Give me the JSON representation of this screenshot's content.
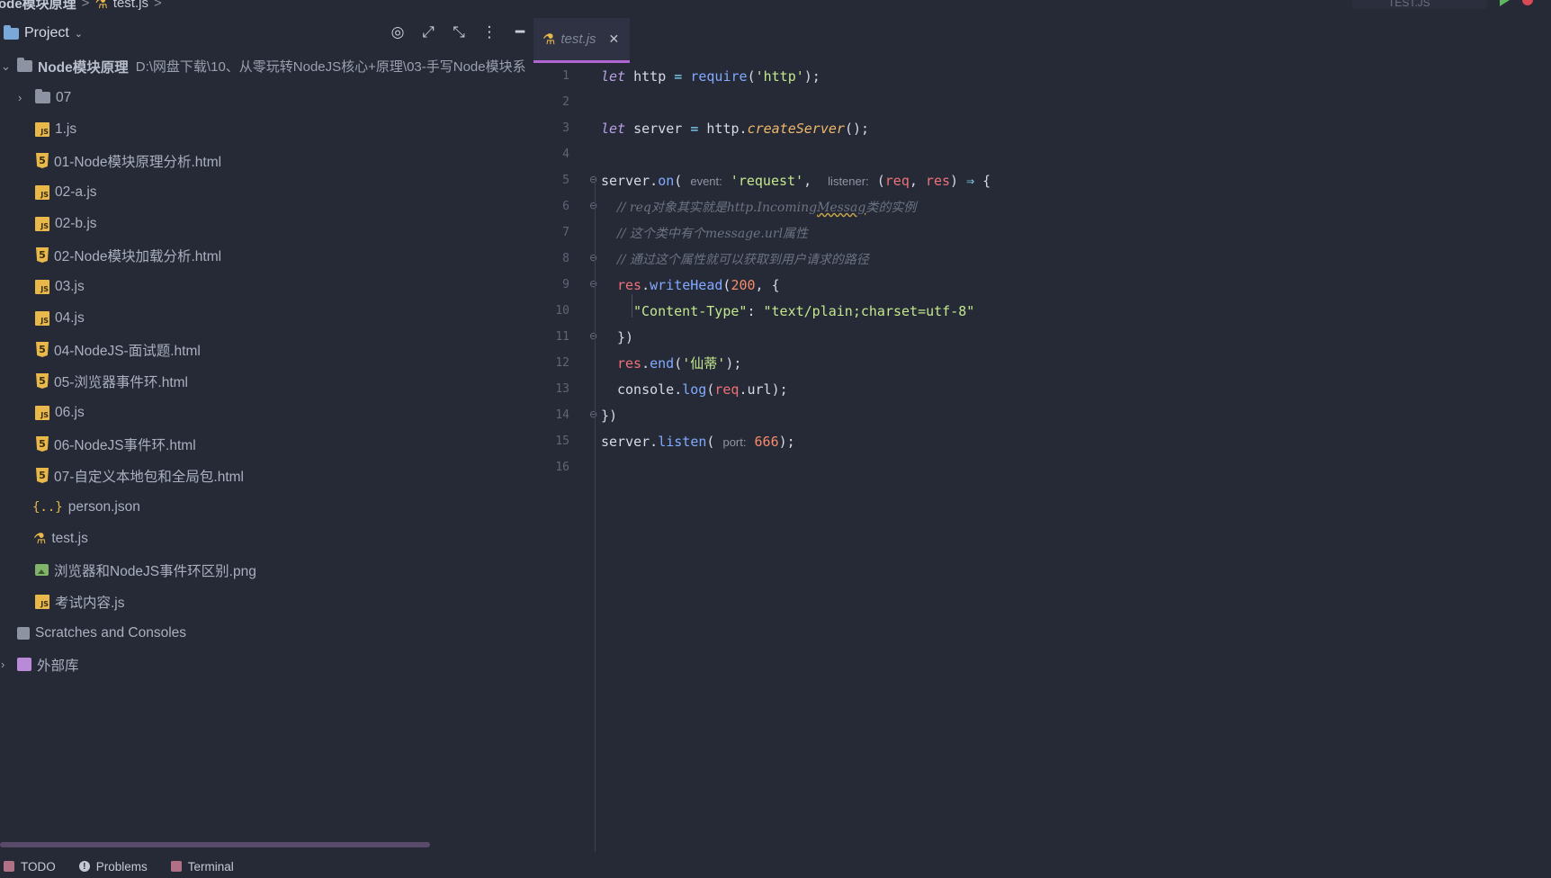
{
  "breadcrumb": {
    "project": "ode模块原理",
    "file": "test.js",
    "sep": ">"
  },
  "run": {
    "config_label": "TEST.JS"
  },
  "project_panel": {
    "title": "Project",
    "root": {
      "name": "Node模块原理",
      "path": "D:\\网盘下载\\10、从零玩转NodeJS核心+原理\\03-手写Node模块系"
    },
    "items": [
      {
        "name": "07",
        "type": "folder"
      },
      {
        "name": "1.js",
        "type": "js"
      },
      {
        "name": "01-Node模块原理分析.html",
        "type": "html"
      },
      {
        "name": "02-a.js",
        "type": "js"
      },
      {
        "name": "02-b.js",
        "type": "js"
      },
      {
        "name": "02-Node模块加载分析.html",
        "type": "html"
      },
      {
        "name": "03.js",
        "type": "js"
      },
      {
        "name": "04.js",
        "type": "js"
      },
      {
        "name": "04-NodeJS-面试题.html",
        "type": "html"
      },
      {
        "name": "05-浏览器事件环.html",
        "type": "html"
      },
      {
        "name": "06.js",
        "type": "js"
      },
      {
        "name": "06-NodeJS事件环.html",
        "type": "html"
      },
      {
        "name": "07-自定义本地包和全局包.html",
        "type": "html"
      },
      {
        "name": "person.json",
        "type": "json"
      },
      {
        "name": "test.js",
        "type": "test"
      },
      {
        "name": "浏览器和NodeJS事件环区别.png",
        "type": "png"
      },
      {
        "name": "考试内容.js",
        "type": "js"
      }
    ],
    "scratches": "Scratches and Consoles",
    "external_libs": "外部库"
  },
  "editor": {
    "tab_name": "test.js",
    "line_numbers": [
      "1",
      "2",
      "3",
      "4",
      "5",
      "6",
      "7",
      "8",
      "9",
      "10",
      "11",
      "12",
      "13",
      "14",
      "15",
      "16"
    ],
    "code": {
      "l1_kw": "let",
      "l1_a": " http ",
      "l1_eq": "=",
      "l1_fn": " require",
      "l1_p1": "(",
      "l1_str": "'http'",
      "l1_p2": ");",
      "l3_kw": "let",
      "l3_a": " server ",
      "l3_eq": "=",
      "l3_b": " http.",
      "l3_fn": "createServer",
      "l3_p": "();",
      "l5_a": "server.",
      "l5_fn": "on",
      "l5_p1": "( ",
      "l5_hint1": "event:",
      "l5_str": "'request'",
      "l5_comma": ",  ",
      "l5_hint2": "listener:",
      "l5_p2": " (",
      "l5_v1": "req",
      "l5_c": ", ",
      "l5_v2": "res",
      "l5_p3": ") ",
      "l5_arrow": "⇒",
      "l5_brace": " {",
      "l6_cmt1": "// req对象其实就是http.Incoming",
      "l6_squig": "Messag",
      "l6_cmt2": "类的实例",
      "l7_cmt": "// 这个类中有个message.url属性",
      "l8_cmt": "// 通过这个属性就可以获取到用户请求的路径",
      "l9_v": "res",
      "l9_dot": ".",
      "l9_fn": "writeHead",
      "l9_p": "(",
      "l9_num": "200",
      "l9_rest": ", {",
      "l10_key": "\"Content-Type\"",
      "l10_colon": ": ",
      "l10_val": "\"text/plain;charset=utf-8\"",
      "l11": "})",
      "l12_v": "res",
      "l12_dot": ".",
      "l12_fn": "end",
      "l12_p1": "(",
      "l12_str": "'仙蒂'",
      "l12_p2": ");",
      "l13_a": "console.",
      "l13_fn": "log",
      "l13_p1": "(",
      "l13_v": "req",
      "l13_b": ".url);",
      "l14": "})",
      "l15_a": "server.",
      "l15_fn": "listen",
      "l15_p1": "( ",
      "l15_hint": "port:",
      "l15_num": " 666",
      "l15_p2": ");"
    }
  },
  "bottom_bar": {
    "todo": "TODO",
    "problems": "Problems",
    "terminal": "Terminal"
  },
  "colors": {
    "background": "#262a37",
    "accent": "#b065d0",
    "keyword": "#b9a0e6",
    "string": "#c3e88d",
    "number": "#f78c6c"
  }
}
